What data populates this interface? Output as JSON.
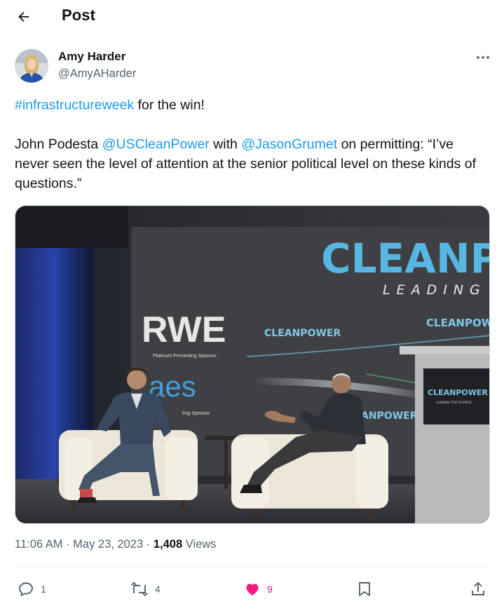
{
  "header": {
    "title": "Post"
  },
  "author": {
    "name": "Amy Harder",
    "handle": "@AmyAHarder"
  },
  "tweet": {
    "line1": {
      "hashtag": "#infrastructureweek",
      "rest": " for the win!"
    },
    "line2": {
      "t1": "John Podesta ",
      "mention1": "@USCleanPower",
      "t2": " with ",
      "mention2": "@JasonGrumet",
      "t3": " on permitting: “I’ve never seen the level of attention at the senior political level on these kinds of questions.”"
    }
  },
  "media": {
    "signs": {
      "cleanpower_big": "CLEANP",
      "leading": "LEADING",
      "rwe": "RWE",
      "sponsor1": "Platinum Presenting Sponsor",
      "aes": "aes",
      "sponsor2": "ting Sponsor",
      "cleanpower_small": "CLEANPOWER",
      "cleanpower_right": "CLEANPOW",
      "anpower": "ANPOWER",
      "podium_logo": "CLEANPOWER",
      "podium_sub": "LEADING THE CHARGE"
    }
  },
  "meta": {
    "time": "11:06 AM",
    "date": "May 23, 2023",
    "views_count": "1,408",
    "views_label": "Views"
  },
  "actions": {
    "replies": "1",
    "reposts": "4",
    "likes": "9"
  },
  "colors": {
    "link": "#1d9bf0",
    "like": "#f91880",
    "muted": "#536471"
  }
}
